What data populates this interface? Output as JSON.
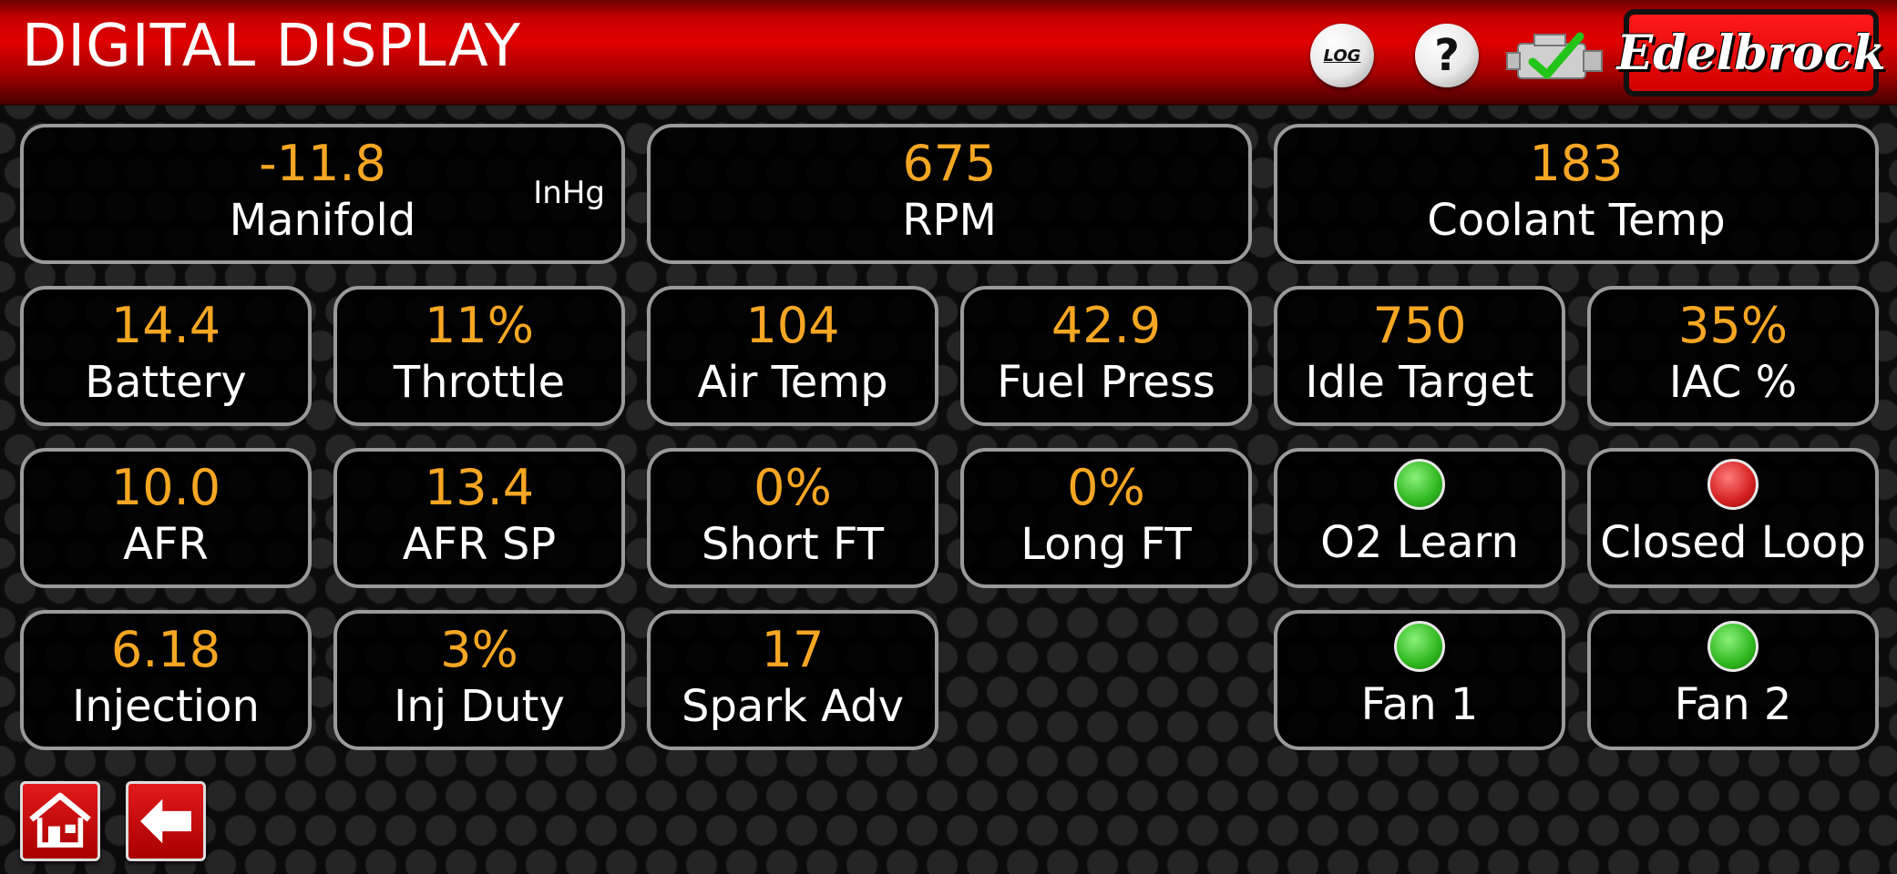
{
  "header": {
    "title": "DIGITAL DISPLAY",
    "log_label": "LOG",
    "help_label": "?",
    "brand": "Edelbrock"
  },
  "colors": {
    "value": "#f5a623",
    "label": "#ffffff",
    "indicator_on": "#2fb81f",
    "indicator_off": "#d42020",
    "header_red": "#d00000"
  },
  "gauges": {
    "manifold": {
      "value": "-11.8",
      "label": "Manifold",
      "unit": "InHg"
    },
    "rpm": {
      "value": "675",
      "label": "RPM"
    },
    "coolant": {
      "value": "183",
      "label": "Coolant Temp"
    },
    "battery": {
      "value": "14.4",
      "label": "Battery"
    },
    "throttle": {
      "value": "11%",
      "label": "Throttle"
    },
    "air_temp": {
      "value": "104",
      "label": "Air Temp"
    },
    "fuel_press": {
      "value": "42.9",
      "label": "Fuel Press"
    },
    "idle_target": {
      "value": "750",
      "label": "Idle Target"
    },
    "iac": {
      "value": "35%",
      "label": "IAC %"
    },
    "afr": {
      "value": "10.0",
      "label": "AFR"
    },
    "afr_sp": {
      "value": "13.4",
      "label": "AFR SP"
    },
    "short_ft": {
      "value": "0%",
      "label": "Short FT"
    },
    "long_ft": {
      "value": "0%",
      "label": "Long FT"
    },
    "injection": {
      "value": "6.18",
      "label": "Injection"
    },
    "inj_duty": {
      "value": "3%",
      "label": "Inj Duty"
    },
    "spark_adv": {
      "value": "17",
      "label": "Spark Adv"
    }
  },
  "indicators": {
    "o2_learn": {
      "label": "O2 Learn",
      "state": "on"
    },
    "closed_loop": {
      "label": "Closed Loop",
      "state": "off"
    },
    "fan1": {
      "label": "Fan 1",
      "state": "on"
    },
    "fan2": {
      "label": "Fan 2",
      "state": "on"
    }
  },
  "icons": {
    "home": "home-icon",
    "back": "arrow-left-icon",
    "engine": "engine-check-icon"
  }
}
